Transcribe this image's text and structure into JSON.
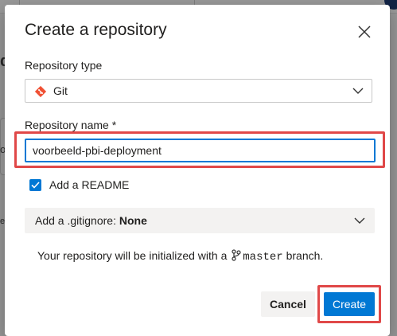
{
  "background": {
    "fragments": [
      "de",
      "om",
      "ers"
    ]
  },
  "dialog": {
    "title": "Create a repository",
    "close_icon": "close-icon",
    "repo_type": {
      "label": "Repository type",
      "value": "Git",
      "icon": "git-icon"
    },
    "repo_name": {
      "label": "Repository name *",
      "value": "voorbeeld-pbi-deployment"
    },
    "readme": {
      "label": "Add a README",
      "checked": true
    },
    "gitignore": {
      "label": "Add a .gitignore:",
      "value": "None"
    },
    "info": {
      "prefix": "Your repository will be initialized with a",
      "branch": "master",
      "suffix": "branch."
    },
    "buttons": {
      "cancel": "Cancel",
      "create": "Create"
    }
  },
  "colors": {
    "accent": "#0078d4",
    "highlight": "#e04848",
    "git_brand": "#f05033"
  }
}
